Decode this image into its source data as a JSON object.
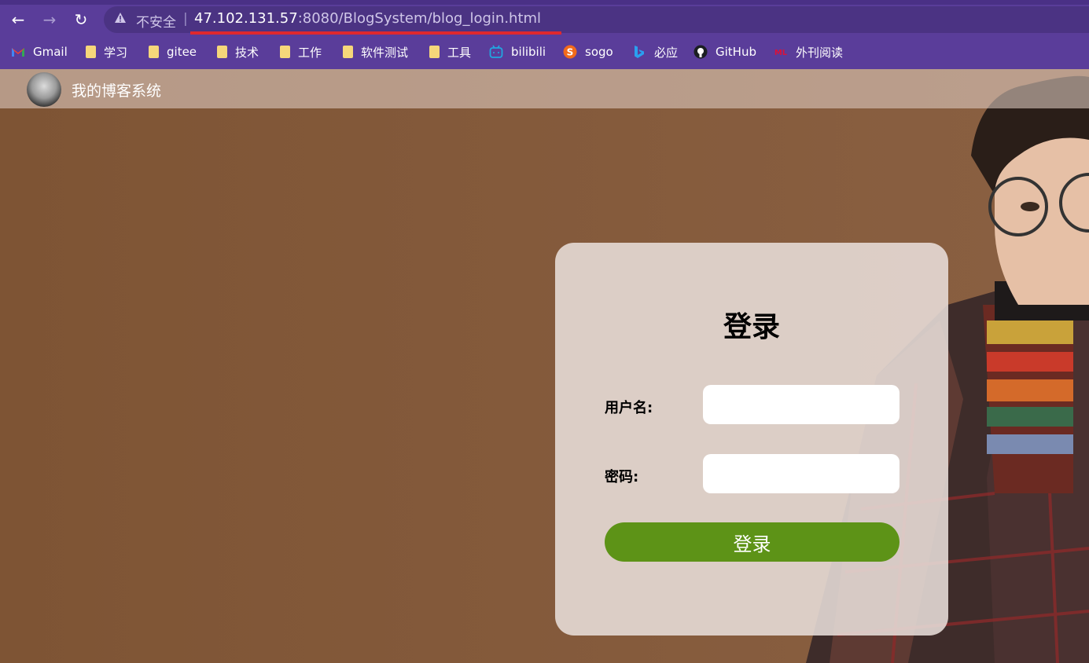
{
  "browser": {
    "back_label": "←",
    "forward_label": "→",
    "reload_label": "↻",
    "security_text": "不安全",
    "separator": "|",
    "url_host": "47.102.131.57",
    "url_rest": ":8080/BlogSystem/blog_login.html"
  },
  "bookmarks": [
    {
      "label": "Gmail",
      "icon": "gmail-icon"
    },
    {
      "label": "学习",
      "icon": "folder-icon"
    },
    {
      "label": "gitee",
      "icon": "folder-icon"
    },
    {
      "label": "技术",
      "icon": "folder-icon"
    },
    {
      "label": "工作",
      "icon": "folder-icon"
    },
    {
      "label": "软件测试",
      "icon": "folder-icon"
    },
    {
      "label": "工具",
      "icon": "folder-icon"
    },
    {
      "label": "bilibili",
      "icon": "bilibili-icon"
    },
    {
      "label": "sogo",
      "icon": "sogo-icon"
    },
    {
      "label": "必应",
      "icon": "bing-icon"
    },
    {
      "label": "GitHub",
      "icon": "github-icon"
    },
    {
      "label": "外刊阅读",
      "icon": "ml-icon"
    }
  ],
  "header": {
    "title": "我的博客系统"
  },
  "login": {
    "title": "登录",
    "username_label": "用户名:",
    "username_value": "",
    "password_label": "密码:",
    "password_value": "",
    "submit_label": "登录"
  },
  "colors": {
    "chrome": "#5a3d9a",
    "submit": "#5d9317",
    "background": "#7f5535"
  }
}
